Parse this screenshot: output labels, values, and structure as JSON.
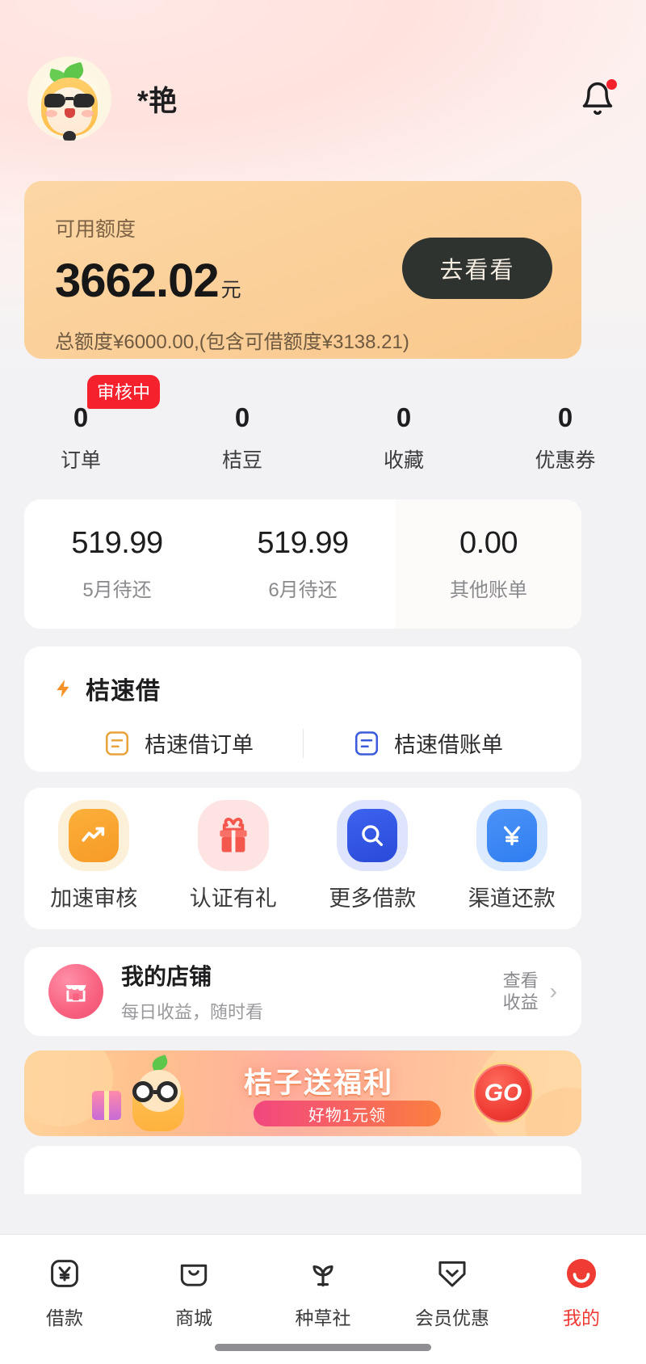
{
  "header": {
    "username": "*艳",
    "avatar_name": "orange-mascot-avatar",
    "bell_icon": "bell-icon",
    "has_notification": true
  },
  "credit_card": {
    "label": "可用额度",
    "amount": "3662.02",
    "unit": "元",
    "subtitle": "总额度¥6000.00,(包含可借额度¥3138.21)",
    "button_label": "去看看",
    "bg_color": "#fbd09a",
    "button_color": "#2f3330"
  },
  "stats": {
    "badge": "审核中",
    "badge_color": "#f5222d",
    "items": [
      {
        "value": "0",
        "label": "订单"
      },
      {
        "value": "0",
        "label": "桔豆"
      },
      {
        "value": "0",
        "label": "收藏"
      },
      {
        "value": "0",
        "label": "优惠券"
      }
    ]
  },
  "bills": [
    {
      "amount": "519.99",
      "label": "5月待还"
    },
    {
      "amount": "519.99",
      "label": "6月待还"
    },
    {
      "amount": "0.00",
      "label": "其他账单"
    }
  ],
  "quick_loan": {
    "title": "桔速借",
    "title_icon": "lightning-bolt-icon",
    "links": [
      {
        "label": "桔速借订单",
        "icon": "document-orange-icon",
        "color": "#e8a33d"
      },
      {
        "label": "桔速借账单",
        "icon": "document-blue-icon",
        "color": "#3b5bdb"
      }
    ]
  },
  "services": [
    {
      "label": "加速审核",
      "icon": "trending-up-icon",
      "color": "#f7a834"
    },
    {
      "label": "认证有礼",
      "icon": "gift-icon",
      "color": "#f4574e"
    },
    {
      "label": "更多借款",
      "icon": "search-icon",
      "color": "#2f55e0"
    },
    {
      "label": "渠道还款",
      "icon": "yen-icon",
      "color": "#3b82f6"
    }
  ],
  "shop": {
    "title": "我的店铺",
    "subtitle": "每日收益，随时看",
    "icon": "shop-icon",
    "action_line1": "查看",
    "action_line2": "收益",
    "chevron": "chevron-right-icon"
  },
  "banner": {
    "title": "桔子送福利",
    "pill": "好物1元领",
    "go_label": "GO",
    "character_icon": "mascot-with-glasses-icon",
    "gift_icon": "gift-box-icon"
  },
  "bottom_nav": [
    {
      "label": "借款",
      "icon": "yen-card-icon",
      "active": false
    },
    {
      "label": "商城",
      "icon": "shop-bag-icon",
      "active": false
    },
    {
      "label": "种草社",
      "icon": "sprout-icon",
      "active": false
    },
    {
      "label": "会员优惠",
      "icon": "heart-tag-icon",
      "active": false
    },
    {
      "label": "我的",
      "icon": "user-profile-icon",
      "active": true
    }
  ],
  "colors": {
    "accent_red": "#ef3b33",
    "page_bg": "#f2f2f4"
  }
}
